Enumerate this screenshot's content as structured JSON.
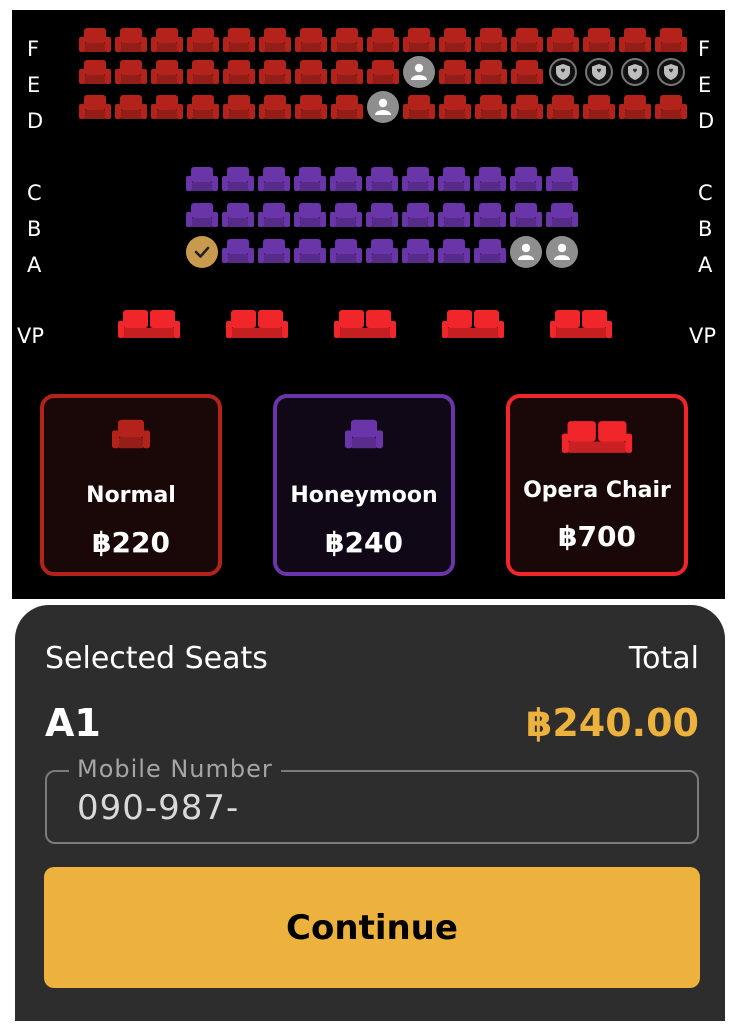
{
  "colors": {
    "normal_seat": "#b3231c",
    "honeymoon_seat": "#6a35a8",
    "opera_seat": "#f0262a",
    "occupied": "#8e8e8e",
    "selected": "#c89a4e",
    "accent": "#ecb23d",
    "panel": "#2d2d2d"
  },
  "seat_map": {
    "row_labels": {
      "F": "F",
      "E": "E",
      "D": "D",
      "C": "C",
      "B": "B",
      "A": "A",
      "VP": "VP"
    },
    "rows": {
      "F": [
        "n",
        "n",
        "n",
        "n",
        "n",
        "n",
        "n",
        "n",
        "n",
        "n",
        "n",
        "n",
        "n",
        "n",
        "n",
        "n",
        "n"
      ],
      "E": [
        "n",
        "n",
        "n",
        "n",
        "n",
        "n",
        "n",
        "n",
        "n",
        "occupied",
        "n",
        "n",
        "n",
        "reserved",
        "reserved",
        "reserved",
        "reserved"
      ],
      "D": [
        "n",
        "n",
        "n",
        "n",
        "n",
        "n",
        "n",
        "n",
        "occupied",
        "n",
        "n",
        "n",
        "n",
        "n",
        "n",
        "n",
        "n"
      ],
      "C": [
        "h",
        "h",
        "h",
        "h",
        "h",
        "h",
        "h",
        "h",
        "h",
        "h",
        "h"
      ],
      "B": [
        "h",
        "h",
        "h",
        "h",
        "h",
        "h",
        "h",
        "h",
        "h",
        "h",
        "h"
      ],
      "A": [
        "selected",
        "h",
        "h",
        "h",
        "h",
        "h",
        "h",
        "h",
        "h",
        "occupied",
        "occupied"
      ],
      "VP": [
        "opera",
        "opera",
        "opera",
        "opera",
        "opera"
      ]
    }
  },
  "legend": [
    {
      "name": "Normal",
      "price": "฿220",
      "color": "#b3231c",
      "icon": "normal-seat-icon"
    },
    {
      "name": "Honeymoon",
      "price": "฿240",
      "color": "#6a35a8",
      "icon": "honeymoon-seat-icon"
    },
    {
      "name": "Opera Chair",
      "price": "฿700",
      "color": "#f0262a",
      "icon": "opera-seat-icon"
    }
  ],
  "summary": {
    "selected_label": "Selected Seats",
    "selected_value": "A1",
    "total_label": "Total",
    "total_value": "฿240.00"
  },
  "mobile": {
    "label": "Mobile Number",
    "value": "090-987-"
  },
  "continue_label": "Continue"
}
